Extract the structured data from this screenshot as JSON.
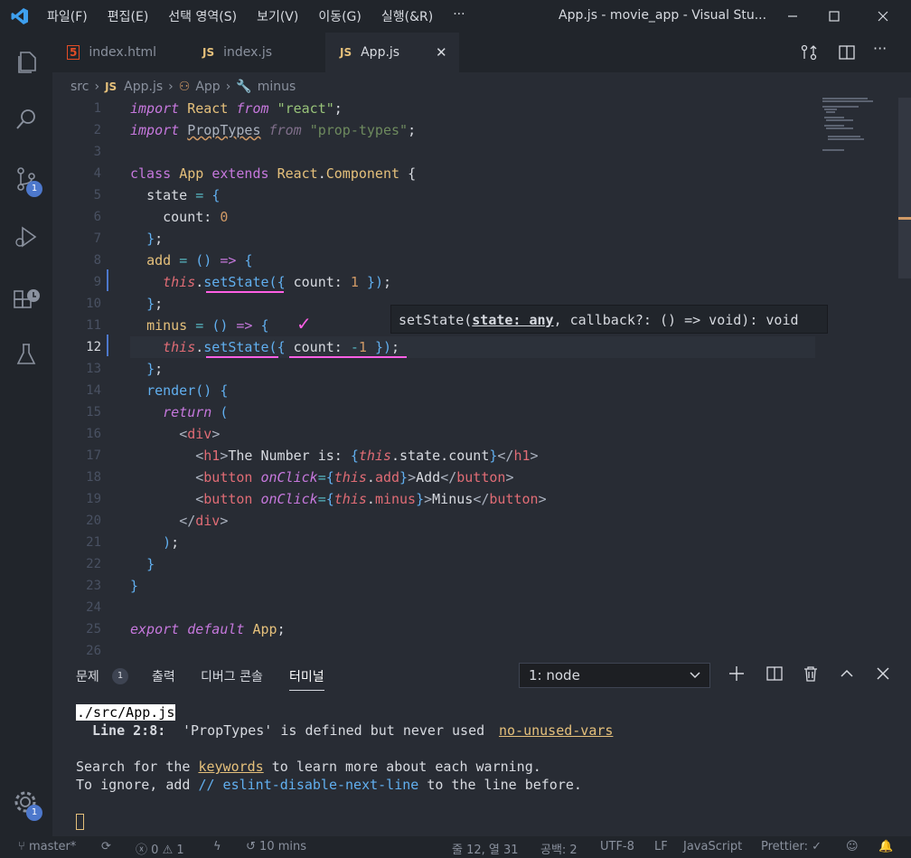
{
  "window": {
    "title": "App.js - movie_app - Visual Stu...",
    "menu": [
      "파일(F)",
      "편집(E)",
      "선택 영역(S)",
      "보기(V)",
      "이동(G)",
      "실행(&R)",
      "···"
    ]
  },
  "activity_bar": {
    "items": [
      {
        "icon": "files-icon"
      },
      {
        "icon": "search-icon"
      },
      {
        "icon": "source-control-icon",
        "badge": "1"
      },
      {
        "icon": "run-debug-icon"
      },
      {
        "icon": "extensions-icon"
      },
      {
        "icon": "testing-icon"
      }
    ],
    "settings_badge": "1"
  },
  "tabs": [
    {
      "icon_label": "5",
      "label": "index.html",
      "active": false
    },
    {
      "icon_label": "JS",
      "label": "index.js",
      "active": false
    },
    {
      "icon_label": "JS",
      "label": "App.js",
      "active": true,
      "close": "✕"
    }
  ],
  "breadcrumb": {
    "folder": "src",
    "file_icon": "JS",
    "file": "App.js",
    "class": "App",
    "member": "minus"
  },
  "code_lines": [
    "1",
    "2",
    "3",
    "4",
    "5",
    "6",
    "7",
    "8",
    "9",
    "10",
    "11",
    "12",
    "13",
    "14",
    "15",
    "16",
    "17",
    "18",
    "19",
    "20",
    "21",
    "22",
    "23",
    "24",
    "25",
    "26"
  ],
  "hover_tooltip": {
    "prefix": "setState(",
    "param": "state: any",
    "suffix": ", callback?: () => void): void"
  },
  "panel": {
    "tabs": [
      {
        "label": "문제",
        "badge": "1"
      },
      {
        "label": "출력"
      },
      {
        "label": "디버그 콘솔"
      },
      {
        "label": "터미널",
        "active": true
      }
    ],
    "terminal_select": "1: node",
    "terminal": {
      "path": "./src/App.js",
      "line_ref": "Line 2:8:",
      "message": "'PropTypes' is defined but never used",
      "rule": "no-unused-vars",
      "search_pre": "Search for the ",
      "search_kw": "keywords",
      "search_post": " to learn more about each warning.",
      "ignore_pre": "To ignore, add ",
      "ignore_comment": "// eslint-disable-next-line",
      "ignore_post": " to the line before."
    }
  },
  "status_bar": {
    "branch": "master*",
    "errors": "0",
    "warnings": "1",
    "time": "10 mins",
    "position": "줄 12, 열 31",
    "spaces": "공백: 2",
    "encoding": "UTF-8",
    "eol": "LF",
    "language": "JavaScript",
    "prettier": "Prettier:"
  }
}
